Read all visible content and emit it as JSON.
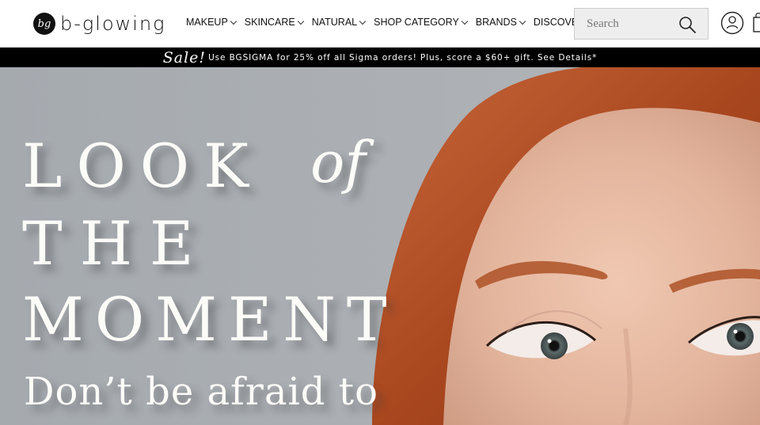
{
  "header": {
    "logo_mark": "bg",
    "logo_text": "b-glowing",
    "nav": [
      {
        "label": "MAKEUP"
      },
      {
        "label": "SKINCARE"
      },
      {
        "label": "NATURAL"
      },
      {
        "label": "SHOP CATEGORY"
      },
      {
        "label": "BRANDS"
      },
      {
        "label": "DISCOVERY"
      }
    ],
    "search": {
      "placeholder": "Search"
    }
  },
  "promo": {
    "sale_label": "Sale!",
    "text": "Use BGSIGMA for 25% off all Sigma orders! Plus, score a $60+ gift. See Details*"
  },
  "hero": {
    "line1": "LOOK",
    "line1_accent": "of",
    "line2": "THE",
    "line3": "MOMENT",
    "subline": "Don’t be afraid to"
  },
  "colors": {
    "promo_bg": "#000000",
    "hero_bg": "#a9aeb3",
    "hair": "#b5532a",
    "skin": "#e6b8a1"
  },
  "icons": {
    "search": "search-icon",
    "account": "user-account-icon",
    "bag": "shopping-bag-icon"
  }
}
